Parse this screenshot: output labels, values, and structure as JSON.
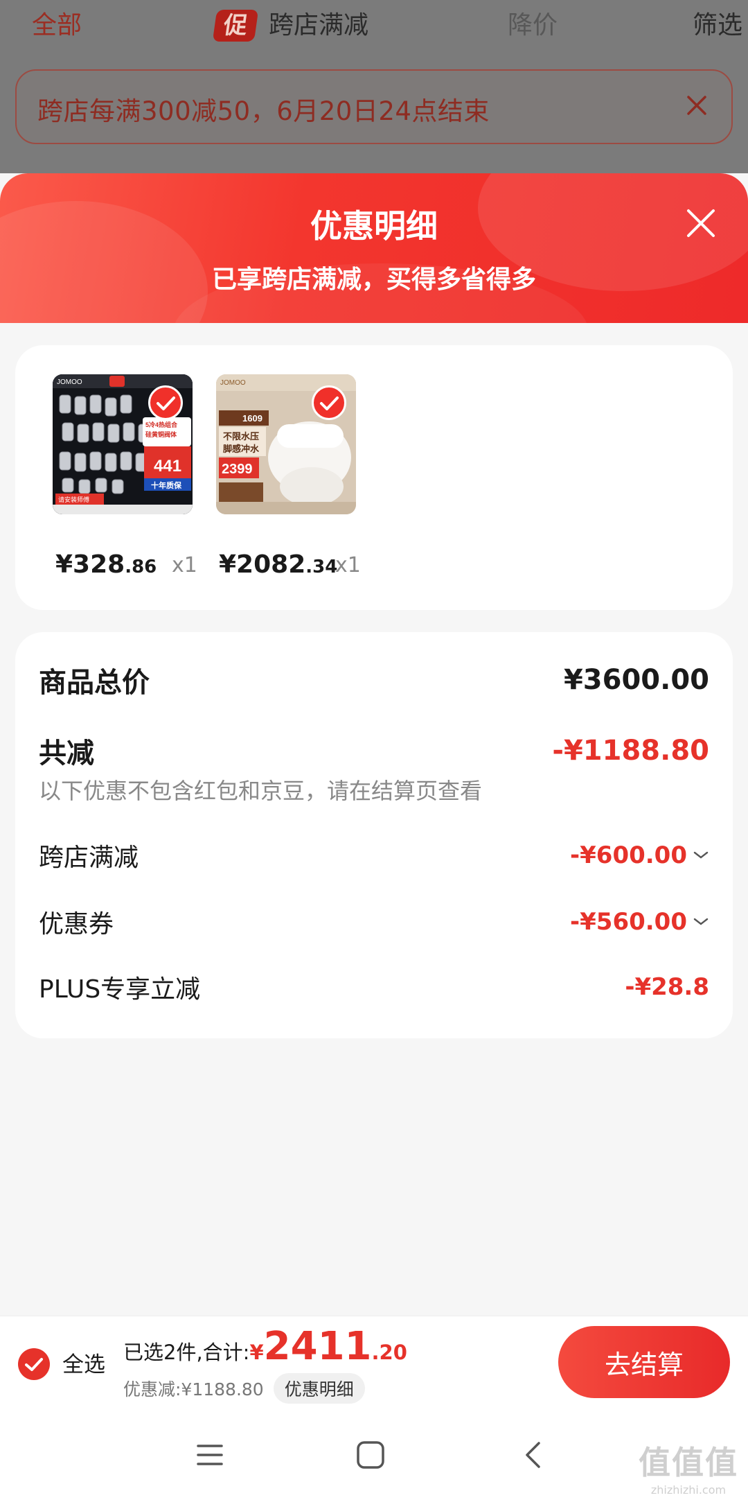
{
  "underlying_page": {
    "tabs": {
      "all": "全部",
      "promo_badge": "促",
      "cross_store": "跨店满减",
      "price_drop": "降价",
      "filter": "筛选"
    },
    "banner_text": "跨店每满300减50，6月20日24点结束"
  },
  "sheet": {
    "title": "优惠明细",
    "subtitle": "已享跨店满减，买得多省得多"
  },
  "products": [
    {
      "price_int": "¥328",
      "price_dec": ".86",
      "qty": "x1",
      "thumb_theme": "faucet-set",
      "thumb_text": {
        "brand": "JOMOO",
        "tag": "5冷4热组合",
        "tag2": "硅黄铜阀体",
        "price": "441",
        "warranty": "十年质保",
        "service": "请安装师傅"
      }
    },
    {
      "price_int": "¥2082",
      "price_dec": ".34",
      "qty": "x1",
      "thumb_theme": "smart-toilet",
      "thumb_text": {
        "brand": "JOMOO",
        "promo": "1609",
        "feature": "不限水压",
        "feature2": "脚感冲水",
        "price": "2399"
      }
    }
  ],
  "summary": {
    "total_label": "商品总价",
    "total_value": "¥3600.00",
    "reduce_label": "共减",
    "reduce_value": "-¥1188.80",
    "note": "以下优惠不包含红包和京豆，请在结算页查看",
    "items": [
      {
        "label": "跨店满减",
        "value": "-¥600.00",
        "expandable": true
      },
      {
        "label": "优惠券",
        "value": "-¥560.00",
        "expandable": true
      },
      {
        "label": "PLUS专享立减",
        "value": "-¥28.8",
        "expandable": false
      }
    ]
  },
  "checkout": {
    "select_all": "全选",
    "selected_label": "已选2件,合计:",
    "total_yen": "¥",
    "total_int": "2411",
    "total_dec": ".20",
    "discount_text": "优惠减:¥1188.80",
    "detail_chip": "优惠明细",
    "button": "去结算"
  },
  "watermark": {
    "big": "值值值",
    "small": "zhizhizhi.com"
  },
  "colors": {
    "accent": "#e6322a",
    "header_gradient_start": "#fb5a4b",
    "header_gradient_end": "#ee2a2a"
  }
}
